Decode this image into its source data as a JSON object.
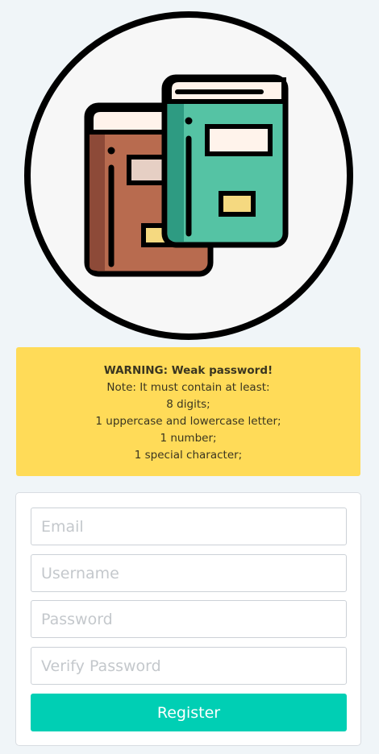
{
  "logo": {
    "icon": "books-icon",
    "colors": {
      "circle_fill": "#f7f7f7",
      "outline": "#000000",
      "book_back": "#b86b4f",
      "book_front": "#55c3a4",
      "pages": "#fff3eb",
      "label": "#f5d980"
    }
  },
  "warning": {
    "title": "WARNING: Weak password!",
    "lines": [
      "Note: It must contain at least:",
      "8 digits;",
      "1 uppercase and lowercase letter;",
      "1 number;",
      "1 special character;"
    ],
    "background": "#ffdb58"
  },
  "form": {
    "email_placeholder": "Email",
    "username_placeholder": "Username",
    "password_placeholder": "Password",
    "verify_placeholder": "Verify Password",
    "submit_label": "Register",
    "accent_color": "#00cfb4"
  }
}
